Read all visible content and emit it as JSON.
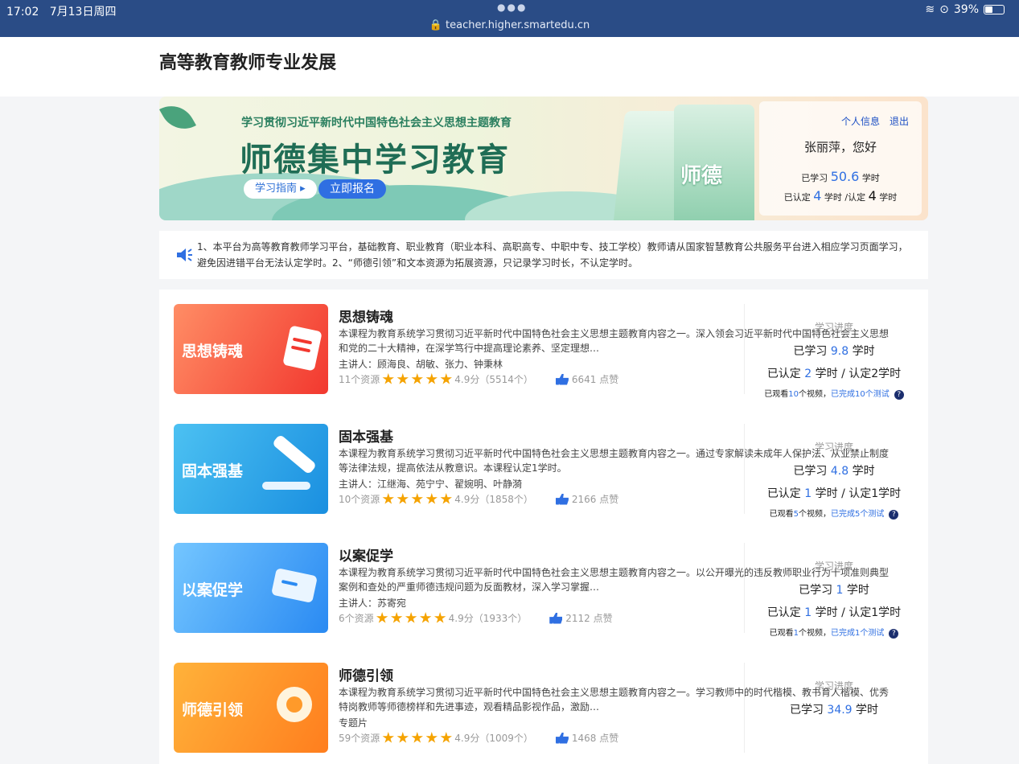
{
  "status_bar": {
    "time": "17:02",
    "date": "7月13日周四",
    "url": "teacher.higher.smartedu.cn",
    "battery": "39%"
  },
  "site": {
    "title": "高等教育教师专业发展"
  },
  "banner": {
    "subtitle": "学习贯彻习近平新时代中国特色社会主义思想主题教育",
    "title": "师德集中学习教育",
    "book_text": "师德",
    "guide_button": "学习指南 ▸",
    "enroll_button": "立即报名"
  },
  "user": {
    "info_link": "个人信息",
    "logout_link": "退出",
    "greeting": "张丽萍，您好",
    "studied_label": "已学习",
    "studied_value": "50.6",
    "hours_unit": "学时",
    "certified_label": "已认定",
    "certified_value": "4",
    "certified_sep": "学时 /认定",
    "required_value": "4"
  },
  "notice": {
    "text": "1、本平台为高等教育教师学习平台，基础教育、职业教育（职业本科、高职高专、中职中专、技工学校）教师请从国家智慧教育公共服务平台进入相应学习页面学习，避免因进错平台无法认定学时。2、“师德引领”和文本资源为拓展资源，只记录学习时长，不认定学时。"
  },
  "courses": [
    {
      "thumb_label": "思想铸魂",
      "title": "思想铸魂",
      "desc": "本课程为教育系统学习贯彻习近平新时代中国特色社会主义思想主题教育内容之一。深入领会习近平新时代中国特色社会主义思想和党的二十大精神，在深学笃行中提高理论素养、坚定理想…",
      "lecturers": "主讲人：顾海良、胡敏、张力、钟秉林",
      "resources": "11个资源",
      "rating": "4.9分（5514个）",
      "likes": "6641 点赞",
      "progress_header": "学习进度",
      "studied_prefix": "已学习",
      "studied": "9.8",
      "studied_suffix": "学时",
      "cert_prefix": "已认定",
      "certified": "2",
      "cert_suffix": "学时 / 认定2学时",
      "watched_prefix": "已观看",
      "watched": "10",
      "watched_suffix": "个视频，",
      "tests": "已完成10个测试"
    },
    {
      "thumb_label": "固本强基",
      "title": "固本强基",
      "desc": "本课程为教育系统学习贯彻习近平新时代中国特色社会主义思想主题教育内容之一。通过专家解读未成年人保护法、从业禁止制度等法律法规，提高依法从教意识。本课程认定1学时。",
      "lecturers": "主讲人：江继海、苑宁宁、翟婉明、叶静漪",
      "resources": "10个资源",
      "rating": "4.9分（1858个）",
      "likes": "2166 点赞",
      "progress_header": "学习进度",
      "studied_prefix": "已学习",
      "studied": "4.8",
      "studied_suffix": "学时",
      "cert_prefix": "已认定",
      "certified": "1",
      "cert_suffix": "学时 / 认定1学时",
      "watched_prefix": "已观看",
      "watched": "5",
      "watched_suffix": "个视频，",
      "tests": "已完成5个测试"
    },
    {
      "thumb_label": "以案促学",
      "title": "以案促学",
      "desc": "本课程为教育系统学习贯彻习近平新时代中国特色社会主义思想主题教育内容之一。以公开曝光的违反教师职业行为十项准则典型案例和查处的严重师德违规问题为反面教材，深入学习掌握…",
      "lecturers": "主讲人：苏寄宛",
      "resources": "6个资源",
      "rating": "4.9分（1933个）",
      "likes": "2112 点赞",
      "progress_header": "学习进度",
      "studied_prefix": "已学习",
      "studied": "1",
      "studied_suffix": "学时",
      "cert_prefix": "已认定",
      "certified": "1",
      "cert_suffix": "学时 / 认定1学时",
      "watched_prefix": "已观看",
      "watched": "1",
      "watched_suffix": "个视频，",
      "tests": "已完成1个测试"
    },
    {
      "thumb_label": "师德引领",
      "title": "师德引领",
      "desc": "本课程为教育系统学习贯彻习近平新时代中国特色社会主义思想主题教育内容之一。学习教师中的时代楷模、教书育人楷模、优秀特岗教师等师德榜样和先进事迹，观看精品影视作品，激励…",
      "lecturers": "专题片",
      "resources": "59个资源",
      "rating": "4.9分（1009个）",
      "likes": "1468 点赞",
      "progress_header": "学习进度",
      "studied_prefix": "已学习",
      "studied": "34.9",
      "studied_suffix": "学时"
    }
  ],
  "colors": {
    "accent": "#2f6fe2",
    "status_bar": "#2a4c86",
    "star": "#f5a300"
  }
}
